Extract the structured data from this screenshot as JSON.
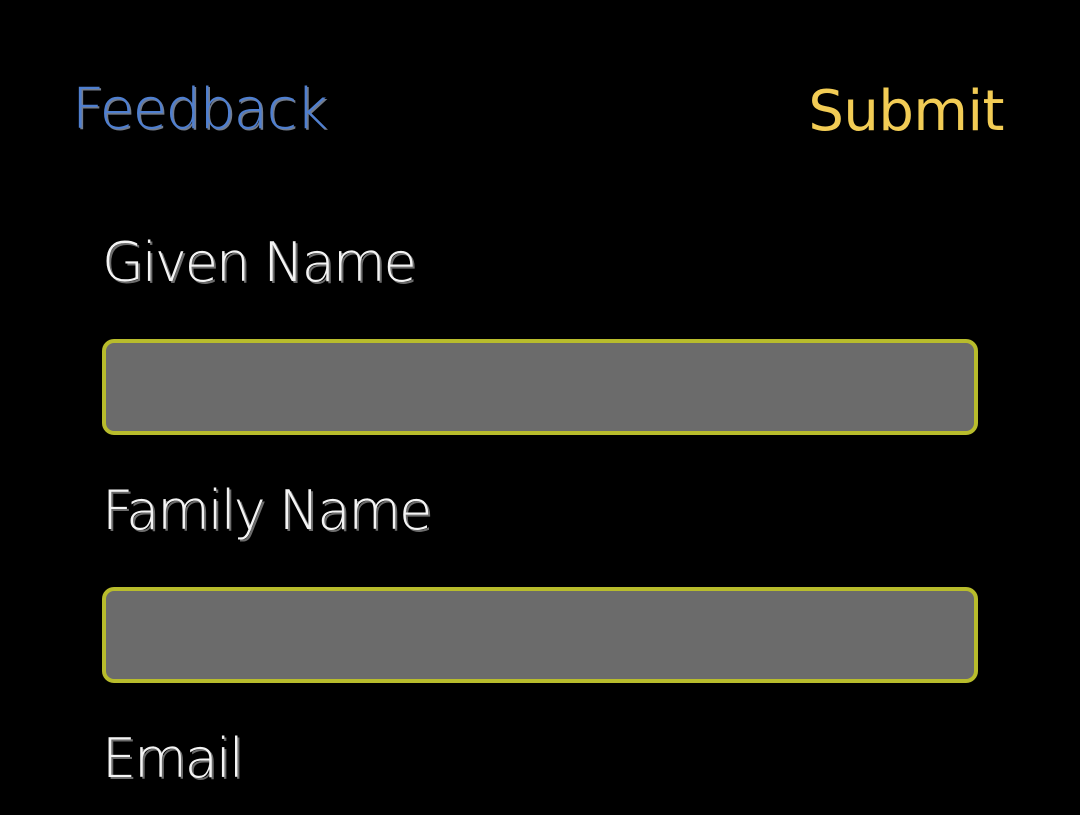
{
  "nav": {
    "title": "Feedback",
    "action_label": "Submit"
  },
  "form": {
    "fields": [
      {
        "label": "Given Name",
        "value": "",
        "placeholder": ""
      },
      {
        "label": "Family Name",
        "value": "",
        "placeholder": ""
      },
      {
        "label": "Email"
      }
    ]
  },
  "colors": {
    "background": "#000000",
    "title": "#4f7fd0",
    "action": "#f2cc55",
    "input_fill": "#6b6b6b",
    "input_border": "#b8bc2c",
    "label": "#f4f4f4"
  }
}
